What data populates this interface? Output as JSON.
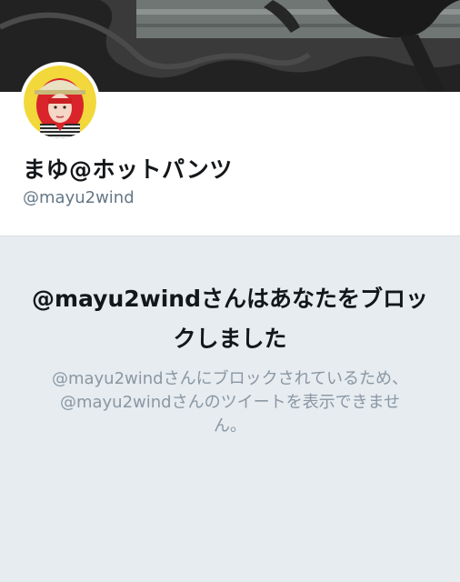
{
  "profile": {
    "display_name": "まゆ@ホットパンツ",
    "handle": "@mayu2wind",
    "banner_icon": "horse-photo-banner",
    "avatar_icon": "user-avatar-photo"
  },
  "blocked_notice": {
    "title": "@mayu2windさんはあなたをブロックしました",
    "message": "@mayu2windさんにブロックされているため、@mayu2windさんのツイートを表示できません。"
  },
  "colors": {
    "background": "#e6ecf0",
    "title_text": "#14171a",
    "secondary_text": "#657786",
    "muted_text": "#8a97a3"
  }
}
